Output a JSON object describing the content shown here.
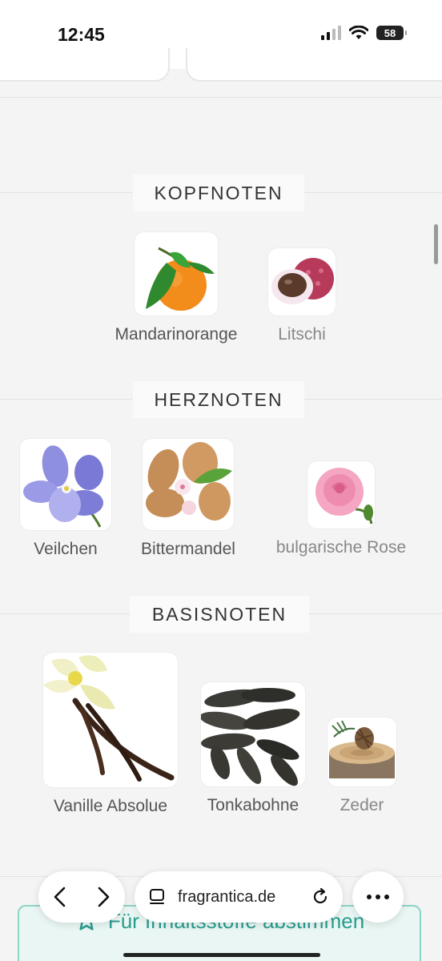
{
  "status": {
    "time": "12:45",
    "battery": "58"
  },
  "sections": {
    "top": {
      "title": "KOPFNOTEN",
      "notes": [
        "Mandarinorange",
        "Litschi"
      ]
    },
    "heart": {
      "title": "HERZNOTEN",
      "notes": [
        "Veilchen",
        "Bittermandel",
        "bulgarische Rose"
      ]
    },
    "base": {
      "title": "BASISNOTEN",
      "notes": [
        "Vanille Absolue",
        "Tonkabohne",
        "Zeder"
      ]
    }
  },
  "vote": {
    "label": "Für Inhaltsstoffe abstimmen"
  },
  "browser": {
    "url": "fragrantica.de"
  },
  "colors": {
    "accent": "#2a9d8f",
    "accent_bg": "#e9f6f3"
  }
}
